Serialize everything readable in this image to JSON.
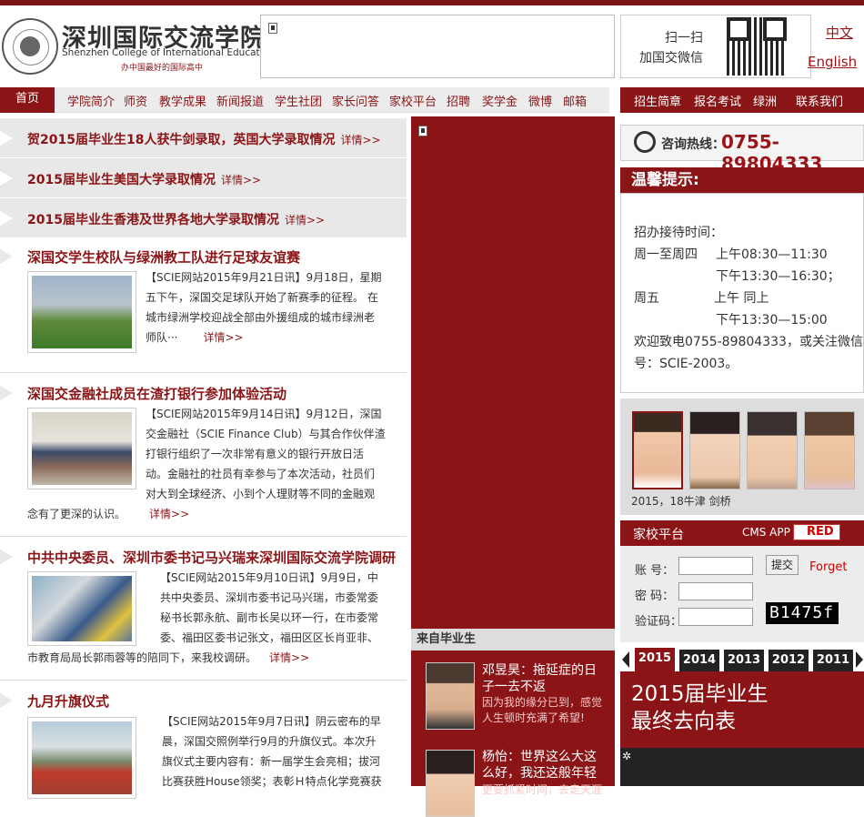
{
  "header": {
    "school_cn": "深圳国际交流学院",
    "school_en": "Shenzhen College of International Education",
    "slogan": "办中国最好的国际高中",
    "wechat_line1": "扫一扫",
    "wechat_line2": "加国交微信",
    "lang_cn": "中文",
    "lang_en": "English"
  },
  "nav": {
    "home": "首页",
    "items": [
      "学院简介",
      "师资",
      "教学成果",
      "新闻报道",
      "学生社团",
      "家长问答",
      "家校平台",
      "招聘",
      "奖学金",
      "微博",
      "邮箱"
    ],
    "right_items": [
      "招生简章",
      "报名考试",
      "绿洲",
      "联系我们"
    ]
  },
  "headlines": [
    {
      "title": "贺2015届毕业生18人获牛剑录取，英国大学录取情况",
      "more": "详情>>"
    },
    {
      "title": "2015届毕业生美国大学录取情况",
      "more": "详情>>"
    },
    {
      "title": "2015届毕业生香港及世界各地大学录取情况",
      "more": "详情>>"
    }
  ],
  "articles": [
    {
      "title": "深国交学生校队与绿洲教工队进行足球友谊赛",
      "l1": "【SCIE网站2015年9月21日讯】9月18日，星期",
      "l2": "五下午，深国交足球队开始了新赛季的征程。 在",
      "l3": "城市绿洲学校迎战全部由外援组成的城市绿洲老",
      "l4": "师队···",
      "more": "详情>>"
    },
    {
      "title": "深国交金融社成员在渣打银行参加体验活动",
      "l1": "【SCIE网站2015年9月14日讯】9月12日，深国",
      "l2": "交金融社（SCIE Finance Club）与其合作伙伴渣",
      "l3": "打银行组织了一次非常有意义的银行开放日活",
      "l4": "动。金融社的社员有幸参与了本次活动，社员们",
      "l5": "对大到全球经济、小到个人理财等不同的金融观",
      "l6": "念有了更深的认识。",
      "more": "详情>>"
    },
    {
      "title": "中共中央委员、深圳市委书记马兴瑞来深圳国际交流学院调研",
      "l1": "【SCIE网站2015年9月10日讯】9月9日，中",
      "l2": "共中央委员、深圳市委书记马兴瑞，市委常委",
      "l3": "秘书长郭永航、副市长吴以环一行，在市委常",
      "l4": "委、福田区委书记张文，福田区区长肖亚非、",
      "l5": "市教育局局长郭雨蓉等的陪同下，来我校调研。",
      "more": "详情>>"
    },
    {
      "title": "九月升旗仪式",
      "l1": "【SCIE网站2015年9月7日讯】阴云密布的早",
      "l2": "晨，深国交照例举行9月的升旗仪式。本次升",
      "l3": "旗仪式主要内容有：新一届学生会亮相；拔河",
      "l4": "比赛获胜House领奖；表彰Ｈ特点化学竞赛获"
    }
  ],
  "graduates": {
    "heading": "来自毕业生",
    "list": [
      {
        "name": "邓昱昊：拖延症的日子一去不返",
        "desc": "因为我的缘分已到，感觉人生顿时充满了希望!"
      },
      {
        "name": "杨怡：世界这么大这么好，我还这般年轻",
        "desc": "更要抓紧时间，去走天涯"
      }
    ]
  },
  "sidebar": {
    "hotline_label": "咨询热线：",
    "hotline_number": "0755-89804333",
    "tips_title": "温馨提示:",
    "tips": {
      "label": "招办接待时间：",
      "r1a": "周一至周四",
      "r1b": "上午08:30—11:30",
      "r2b": "下午13:30—16:30；",
      "r3a": "周五",
      "r3b": "上午  同上",
      "r4b": "下午13:30—15:00",
      "n1": "欢迎致电0755-89804333，或关注微信",
      "n2": "号：SCIE-2003。"
    },
    "faces_caption": "2015，18牛津 剑桥",
    "homeschool_title": "家校平台",
    "cms_label": "CMS APP",
    "red_badge": "RED",
    "login": {
      "account_label": "账 号：",
      "password_label": "密 码：",
      "captcha_label": "验证码：",
      "submit": "提交",
      "forget": "Forget",
      "captcha_text": "B1475f"
    },
    "years": [
      "2015",
      "2014",
      "2013",
      "2012",
      "2011"
    ],
    "grad_banner_l1": "2015届毕业生",
    "grad_banner_l2": "最终去向表"
  },
  "colors": {
    "brand": "#8b1416",
    "accent": "#9a1418"
  }
}
